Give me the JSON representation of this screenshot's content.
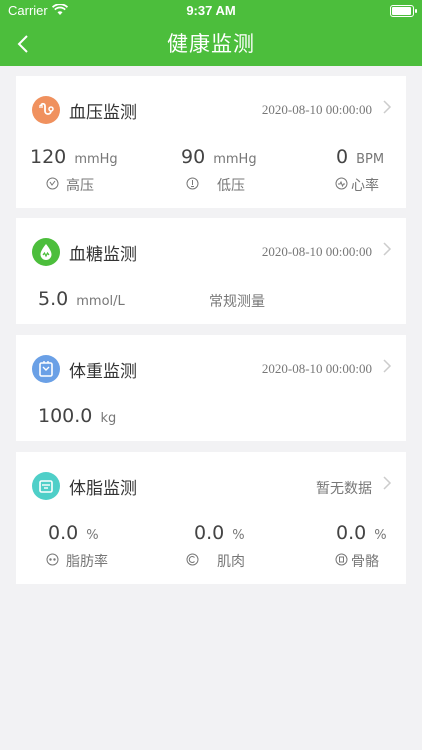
{
  "status_bar": {
    "carrier": "Carrier",
    "time": "9:37 AM"
  },
  "header": {
    "title": "健康监测",
    "back_icon": "back-chevron-icon"
  },
  "colors": {
    "header_bg": "#4cbe3c",
    "bp_icon": "#f0915e",
    "sugar_icon": "#4cbe3c",
    "weight_icon": "#6aa0e6",
    "fat_icon": "#4fcfc8"
  },
  "blood_pressure": {
    "title": "血压监测",
    "date": "2020-08-10 00:00:00",
    "systolic": {
      "value": "120",
      "unit": "mmHg",
      "label": "高压"
    },
    "diastolic": {
      "value": "90",
      "unit": "mmHg",
      "label": "低压"
    },
    "heart_rate": {
      "value": "0",
      "unit": "BPM",
      "label": "心率"
    }
  },
  "blood_sugar": {
    "title": "血糖监测",
    "date": "2020-08-10 00:00:00",
    "value": "5.0",
    "unit": "mmol/L",
    "type": "常规测量"
  },
  "weight": {
    "title": "体重监测",
    "date": "2020-08-10 00:00:00",
    "value": "100.0",
    "unit": "kg"
  },
  "body_fat": {
    "title": "体脂监测",
    "status": "暂无数据",
    "fat_rate": {
      "value": "0.0",
      "unit": "%",
      "label": "脂肪率"
    },
    "muscle": {
      "value": "0.0",
      "unit": "%",
      "label": "肌肉"
    },
    "bone": {
      "value": "0.0",
      "unit": "%",
      "label": "骨骼"
    }
  }
}
